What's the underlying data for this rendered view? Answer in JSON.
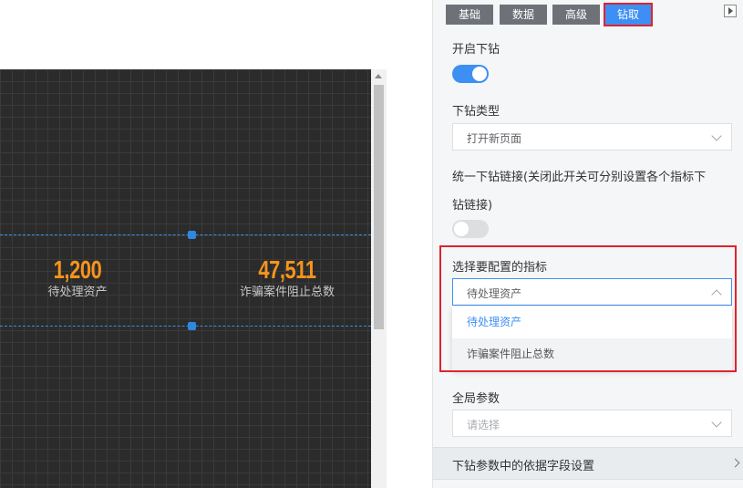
{
  "canvas": {
    "metrics": [
      {
        "value": "1,200",
        "label": "待处理资产"
      },
      {
        "value": "47,511",
        "label": "诈骗案件阻止总数"
      }
    ]
  },
  "panel": {
    "tabs": [
      {
        "label": "基础",
        "active": false
      },
      {
        "label": "数据",
        "active": false
      },
      {
        "label": "高级",
        "active": false
      },
      {
        "label": "钻取",
        "active": true
      }
    ],
    "enable_drill": {
      "label": "开启下钻",
      "state": "on"
    },
    "drill_type": {
      "label": "下钻类型",
      "value": "打开新页面"
    },
    "unified_link": {
      "label_line1": "统一下钻链接(关闭此开关可分别设置各个指标下",
      "label_line2": "钻链接)",
      "state": "off"
    },
    "indicator": {
      "label": "选择要配置的指标",
      "value": "待处理资产",
      "options": [
        "待处理资产",
        "诈骗案件阻止总数"
      ],
      "selected_option": "待处理资产"
    },
    "global_params": {
      "label": "全局参数",
      "placeholder": "请选择"
    },
    "footer": {
      "label": "下钻参数中的依据字段设置"
    }
  },
  "colors": {
    "accent": "#3d8ff4",
    "highlight": "#e0232f",
    "metric": "#f7941d"
  }
}
